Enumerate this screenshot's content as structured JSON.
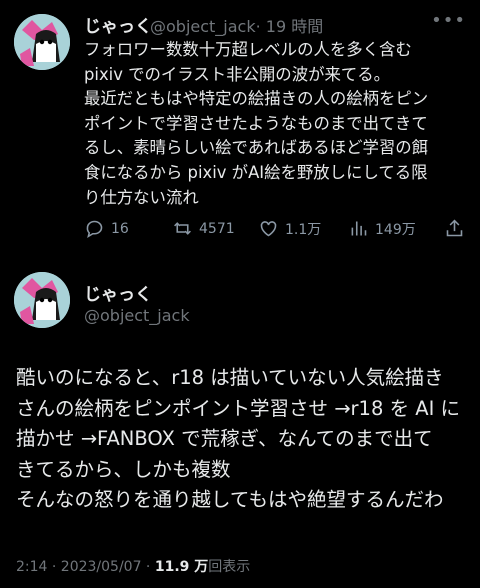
{
  "tweet1": {
    "name": "じゃっく",
    "handle": "@object_jack",
    "time": "· 19 時間",
    "text": "フォロワー数数十万超レベルの人を多く含む\npixiv でのイラスト非公開の波が来てる。\n最近だともはや特定の絵描きの人の絵柄をピン\nポイントで学習させたようなものまで出てきて\nるし、素晴らしい絵であればあるほど学習の餌\n食になるから pixiv がAI絵を野放しにしてる限\nり仕方ない流れ",
    "replies": "16",
    "retweets": "4571",
    "likes": "1.1万",
    "views": "149万"
  },
  "tweet2": {
    "name": "じゃっく",
    "handle": "@object_jack",
    "text": "酷いのになると、r18 は描いていない人気絵描き\nさんの絵柄をピンポイント学習させ →r18 を AI に\n描かせ →FANBOX で荒稼ぎ、なんてのまで出て\nきてるから、しかも複数\nそんなの怒りを通り越してもはや絶望するんだわ",
    "time": "2:14 · 2023/05/07 · ",
    "view_count": "11.9 万",
    "view_label": "回表示"
  },
  "icons": [
    "more-icon",
    "reply-icon",
    "retweet-icon",
    "like-icon",
    "views-icon",
    "share-icon"
  ]
}
